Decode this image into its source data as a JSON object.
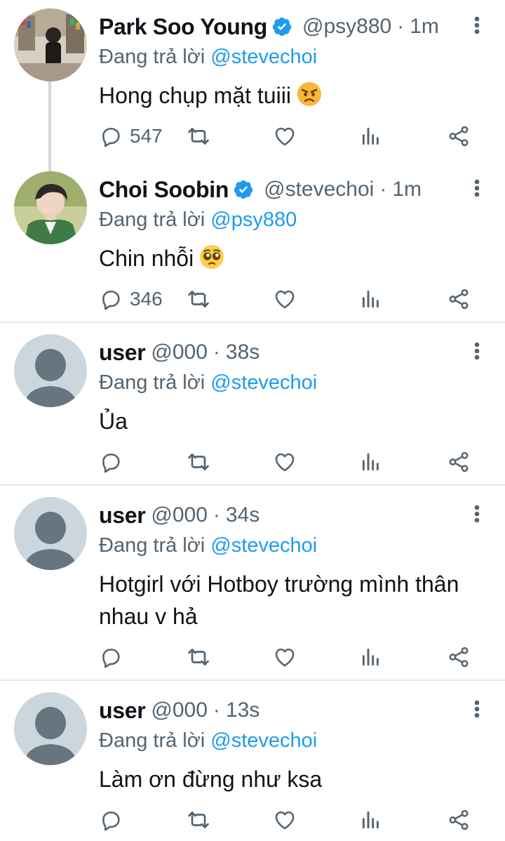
{
  "replying_prefix": "Đang trả lời",
  "tweets": [
    {
      "name": "Park Soo Young",
      "verified": true,
      "handle": "@psy880",
      "sep": "·",
      "time": "1m",
      "replying_to": "@stevechoi",
      "text": "Hong chụp mặt tuiii",
      "emoji": "angry-face",
      "replies": "547",
      "avatar": "photo-avatar"
    },
    {
      "name": "Choi Soobin",
      "verified": true,
      "handle": "@stevechoi",
      "sep": "·",
      "time": "1m",
      "replying_to": "@psy880",
      "text": "Chin nhỗi",
      "emoji": "pleading-face",
      "replies": "346",
      "avatar": "photo-avatar"
    },
    {
      "name": "user",
      "verified": false,
      "handle": "@000",
      "sep": "·",
      "time": "38s",
      "replying_to": "@stevechoi",
      "text": "Ủa",
      "replies": "",
      "avatar": "default-avatar"
    },
    {
      "name": "user",
      "verified": false,
      "handle": "@000",
      "sep": "·",
      "time": "34s",
      "replying_to": "@stevechoi",
      "text": "Hotgirl với Hotboy trường mình thân nhau v hả",
      "replies": "",
      "avatar": "default-avatar"
    },
    {
      "name": "user",
      "verified": false,
      "handle": "@000",
      "sep": "·",
      "time": "13s",
      "replying_to": "@stevechoi",
      "text": "Làm ơn đừng như ksa",
      "replies": "",
      "avatar": "default-avatar"
    }
  ],
  "colors": {
    "accent": "#1d9bf0",
    "secondary_text": "#536471",
    "divider": "#e6e9ec",
    "default_avatar_bg": "#ccd6dd",
    "default_avatar_fg": "#66757f"
  }
}
